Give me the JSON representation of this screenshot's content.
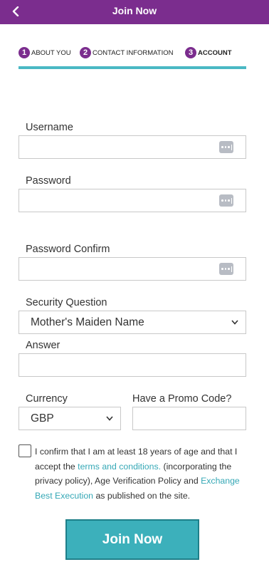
{
  "header": {
    "title": "Join Now"
  },
  "steps": [
    {
      "number": "1",
      "label": "ABOUT YOU"
    },
    {
      "number": "2",
      "label": "CONTACT INFORMATION"
    },
    {
      "number": "3",
      "label": "ACCOUNT"
    }
  ],
  "form": {
    "username_label": "Username",
    "username_value": "",
    "password_label": "Password",
    "password_value": "",
    "password_confirm_label": "Password Confirm",
    "password_confirm_value": "",
    "security_question_label": "Security Question",
    "security_question_value": "Mother's Maiden Name",
    "answer_label": "Answer",
    "answer_value": "",
    "currency_label": "Currency",
    "currency_value": "GBP",
    "promo_label": "Have a Promo Code?",
    "promo_value": ""
  },
  "consent": {
    "checked": false,
    "text_1": "I confirm that I am at least 18 years of age and that I accept the ",
    "terms_link": "terms and conditions.",
    "text_2": " (incorporating the privacy policy), Age Verification Policy and ",
    "exchange_link": "Exchange Best Execution",
    "text_3": " as published on the site."
  },
  "join_button_label": "Join Now",
  "colors": {
    "header_bg": "#7b2d8e",
    "accent": "#3cb0bb",
    "link": "#35a8b6"
  },
  "icons": {
    "back": "chevron-left-icon",
    "password_manager": "dots-icon",
    "dropdown": "chevron-down-icon"
  }
}
